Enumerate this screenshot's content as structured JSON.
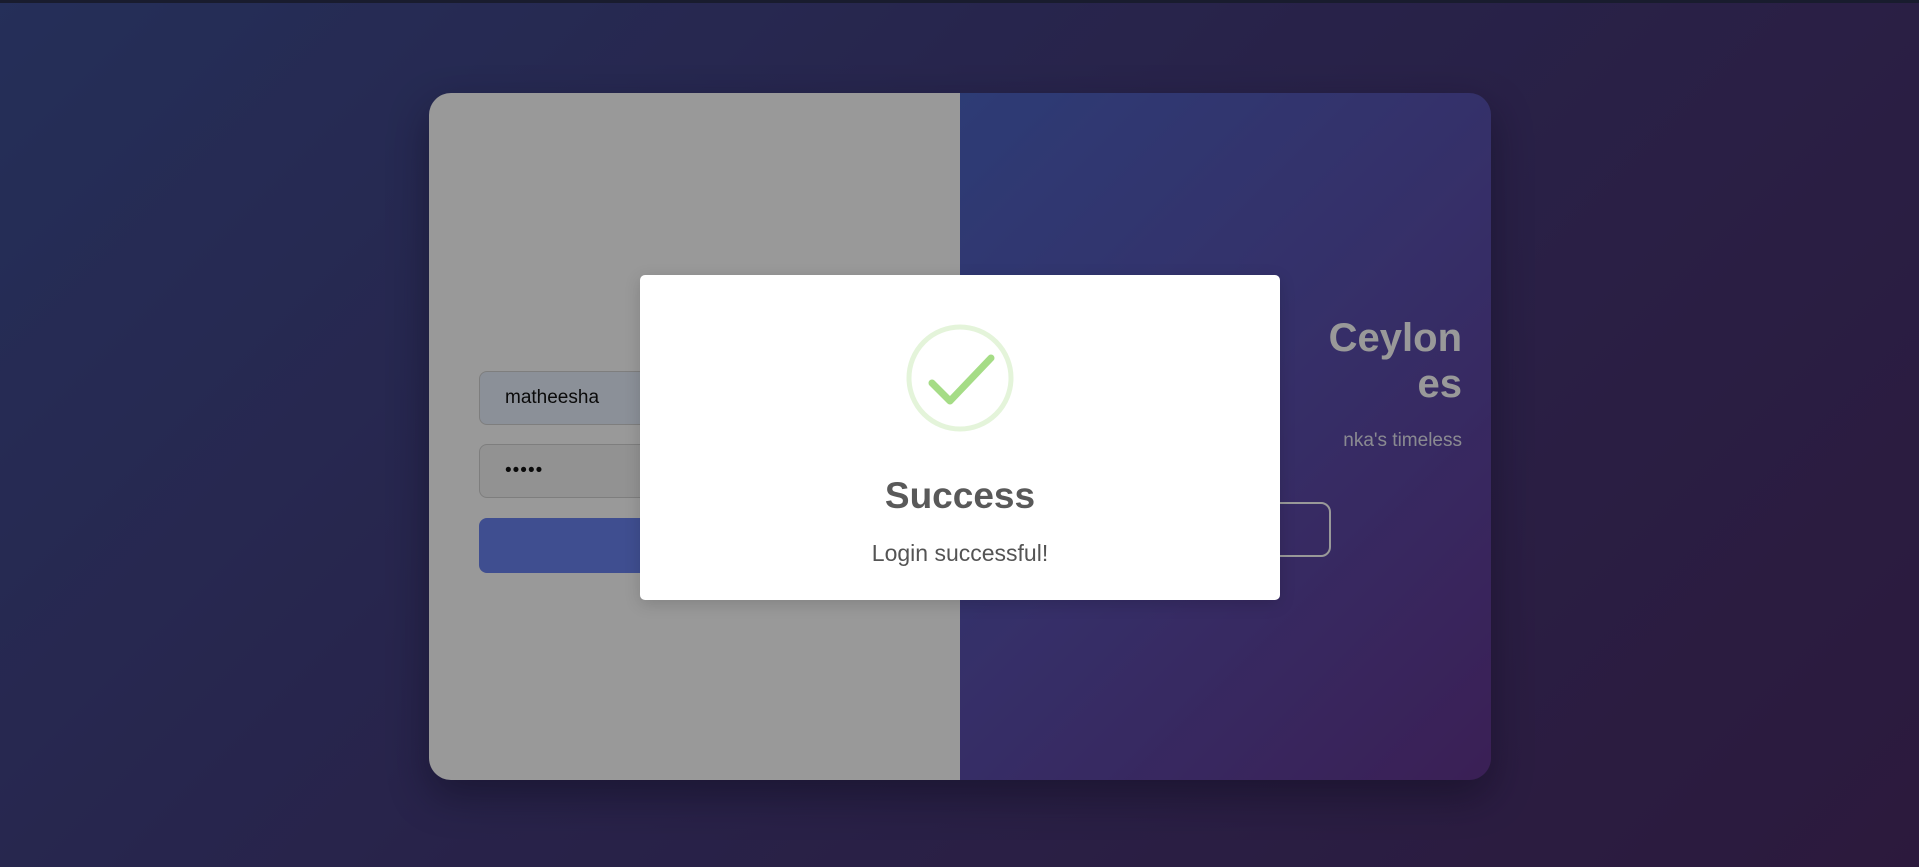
{
  "login_form": {
    "username_value": "matheesha",
    "password_value": "•••••"
  },
  "welcome_panel": {
    "title": "Ceylon es",
    "text": "nka's timeless"
  },
  "modal": {
    "title": "Success",
    "message": "Login successful!",
    "icon": "check-icon"
  },
  "colors": {
    "background_start": "#3e4f94",
    "background_end": "#4a2b66",
    "primary_button": "#6a82f0",
    "success_green": "#a5dc86"
  }
}
